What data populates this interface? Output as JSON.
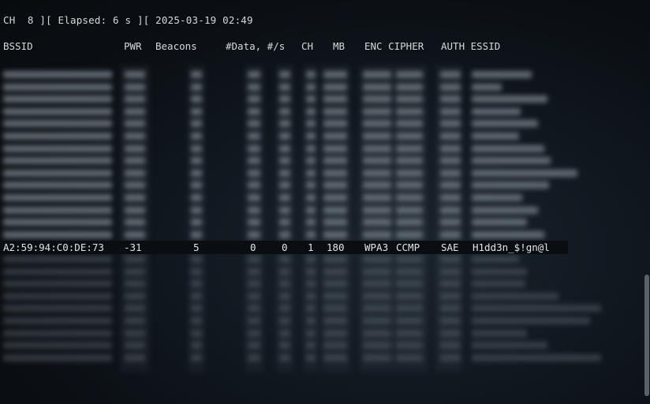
{
  "status": {
    "text": "CH  8 ][ Elapsed: 6 s ][ 2025-03-19 02:49"
  },
  "columns": {
    "bssid": "BSSID",
    "pwr": "PWR",
    "beacons": "Beacons",
    "data": "#Data, #/s",
    "ch": "CH",
    "mb": "MB",
    "enc_cipher": "ENC CIPHER",
    "auth_essid": "AUTH ESSID"
  },
  "visible_network": {
    "bssid": "A2:59:94:C0:DE:73",
    "pwr": "-31",
    "beacons": "5",
    "data": "0",
    "per_s": "0",
    "ch": "1",
    "mb": "180",
    "enc": "WPA3",
    "cipher": "CCMP",
    "auth": "SAE",
    "essid": "H1dd3n_$!gn@l"
  },
  "colors": {
    "background": "#0a0d11",
    "text": "#d6d9dc",
    "scrollbar": "#5b6168"
  }
}
